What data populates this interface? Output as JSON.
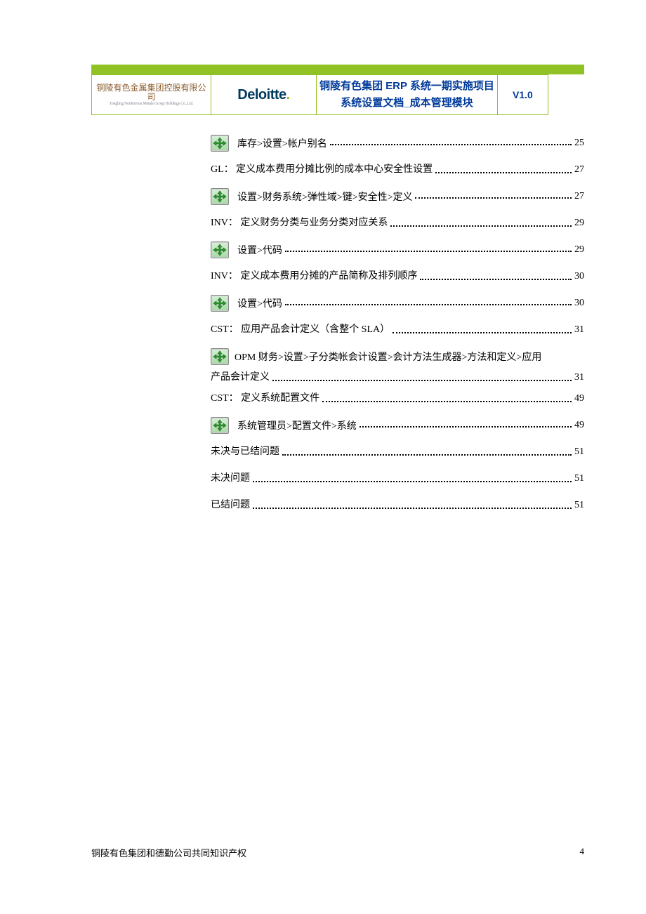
{
  "header": {
    "logo_cn": "铜陵有色金属集团控股有限公司",
    "logo_en": "Tongling Nonferrous Metals Group Holdings Co.,Ltd.",
    "deloitte": "Deloitte",
    "title_line1": "铜陵有色集团 ERP 系统一期实施项目",
    "title_line2": "系统设置文档_成本管理模块",
    "version": "V1.0"
  },
  "toc": [
    {
      "icon": true,
      "text": " 库存>设置>帐户别名",
      "page": "25"
    },
    {
      "icon": false,
      "text": "GL：  定义成本费用分摊比例的成本中心安全性设置",
      "page": "27"
    },
    {
      "icon": true,
      "text": " 设置>财务系统>弹性域>键>安全性>定义",
      "page": "27"
    },
    {
      "icon": false,
      "text": "INV： 定义财务分类与业务分类对应关系",
      "page": "29"
    },
    {
      "icon": true,
      "text": " 设置>代码",
      "page": "29"
    },
    {
      "icon": false,
      "text": "INV： 定义成本费用分摊的产品简称及排列顺序",
      "page": "30"
    },
    {
      "icon": true,
      "text": " 设置>代码",
      "page": "30"
    },
    {
      "icon": false,
      "text": "CST： 应用产品会计定义（含整个 SLA）",
      "page": "31"
    },
    {
      "icon": true,
      "multi": true,
      "text1": " OPM 财务>设置>子分类帐会计设置>会计方法生成器>方法和定义>应用",
      "text2": "产品会计定义",
      "page": "31"
    },
    {
      "icon": false,
      "text": "CST： 定义系统配置文件",
      "page": "49"
    },
    {
      "icon": true,
      "text": " 系统管理员>配置文件>系统",
      "page": "49"
    },
    {
      "icon": false,
      "text": "未决与已结问题",
      "page": "51"
    },
    {
      "icon": false,
      "text": "未决问题",
      "page": "51"
    },
    {
      "icon": false,
      "text": "已结问题",
      "page": "51"
    }
  ],
  "footer": {
    "left": "铜陵有色集团和德勤公司共同知识产权",
    "right": "4"
  }
}
